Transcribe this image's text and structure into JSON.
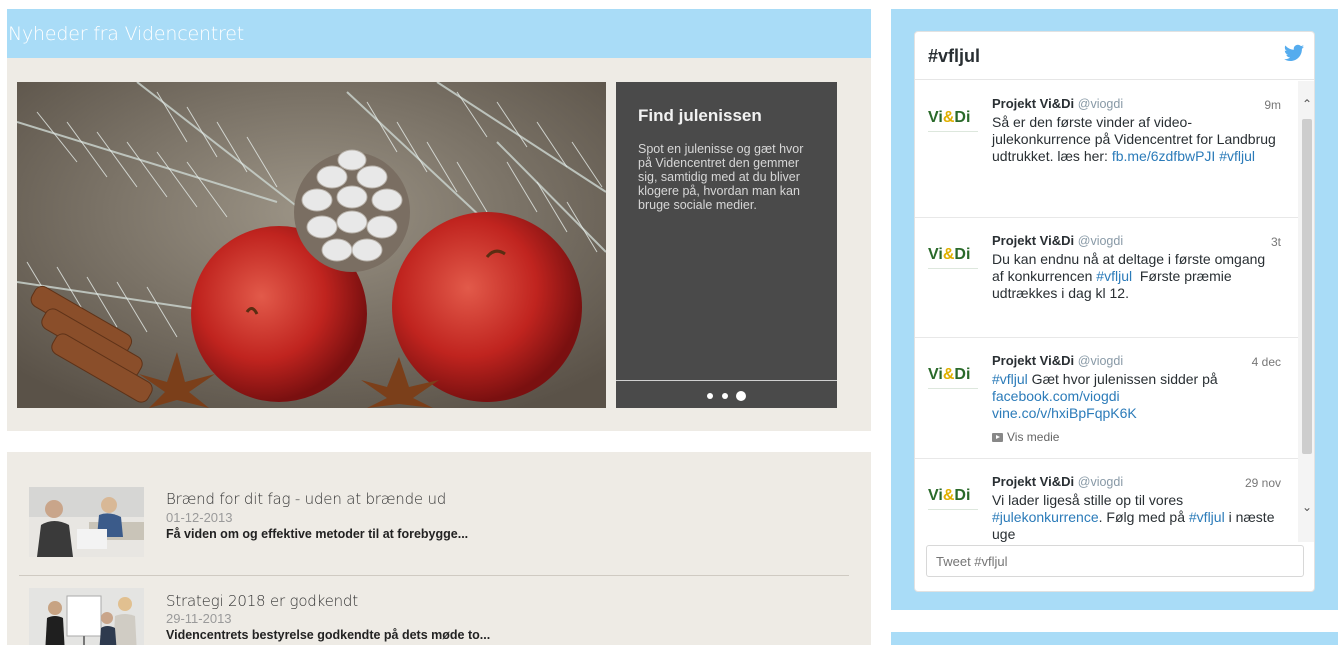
{
  "news": {
    "header_title": "Nyheder fra Videncentret",
    "slider": {
      "caption_title": "Find julenissen",
      "caption_text": "Spot en julenisse og gæt hvor på Videncentret den gemmer sig, samtidig med at du bliver klogere på, hvordan man kan bruge sociale medier.",
      "dots": 3,
      "active_dot": 3
    },
    "items": [
      {
        "title": "Brænd for dit fag - uden at brænde ud",
        "date": "01-12-2013",
        "excerpt": "Få viden om og effektive metoder til at forebygge..."
      },
      {
        "title": "Strategi 2018 er godkendt",
        "date": "29-11-2013",
        "excerpt": "Videncentrets bestyrelse godkendte på dets møde to..."
      }
    ]
  },
  "twitter": {
    "title": "#vfljul",
    "tweet_placeholder": "Tweet #vfljul",
    "avatar_text_1": "Vi",
    "avatar_text_2": "&",
    "avatar_text_3": "Di",
    "tweets": [
      {
        "name": "Projekt Vi&Di",
        "handle": "@viogdi",
        "time": "9m",
        "text_parts": [
          "Så er den første vinder af video-julekonkurrence på Videncentret for Landbrug udtrukket. læs her: "
        ],
        "link1": "fb.me/6zdfbwPJI",
        "link2": "#vfljul"
      },
      {
        "name": "Projekt Vi&Di",
        "handle": "@viogdi",
        "time": "3t",
        "text_a": "Du kan endnu nå at deltage i første omgang af konkurrencen ",
        "link1": "#vfljul",
        "text_b": "  Første præmie udtrækkes i dag kl 12."
      },
      {
        "name": "Projekt Vi&Di",
        "handle": "@viogdi",
        "time": "4 dec",
        "link1": "#vfljul",
        "text_a": " Gæt hvor julenissen sidder på ",
        "link2": "facebook.com/viogdi",
        "link3": "vine.co/v/hxiBpFqpK6K",
        "media_label": "Vis medie"
      },
      {
        "name": "Projekt Vi&Di",
        "handle": "@viogdi",
        "time": "29 nov",
        "text_a": "Vi lader ligeså stille op til vores ",
        "link1": "#julekonkurrence",
        "text_b": ". Følg med på ",
        "link2": "#vfljul",
        "text_c": " i næste uge"
      }
    ]
  },
  "colors": {
    "header_blue": "#a9dcf7",
    "panel_beige": "#eeebe5",
    "caption_dark": "#4a4a4a",
    "link_blue": "#2b7bb9",
    "twitter_blue": "#55acee"
  }
}
